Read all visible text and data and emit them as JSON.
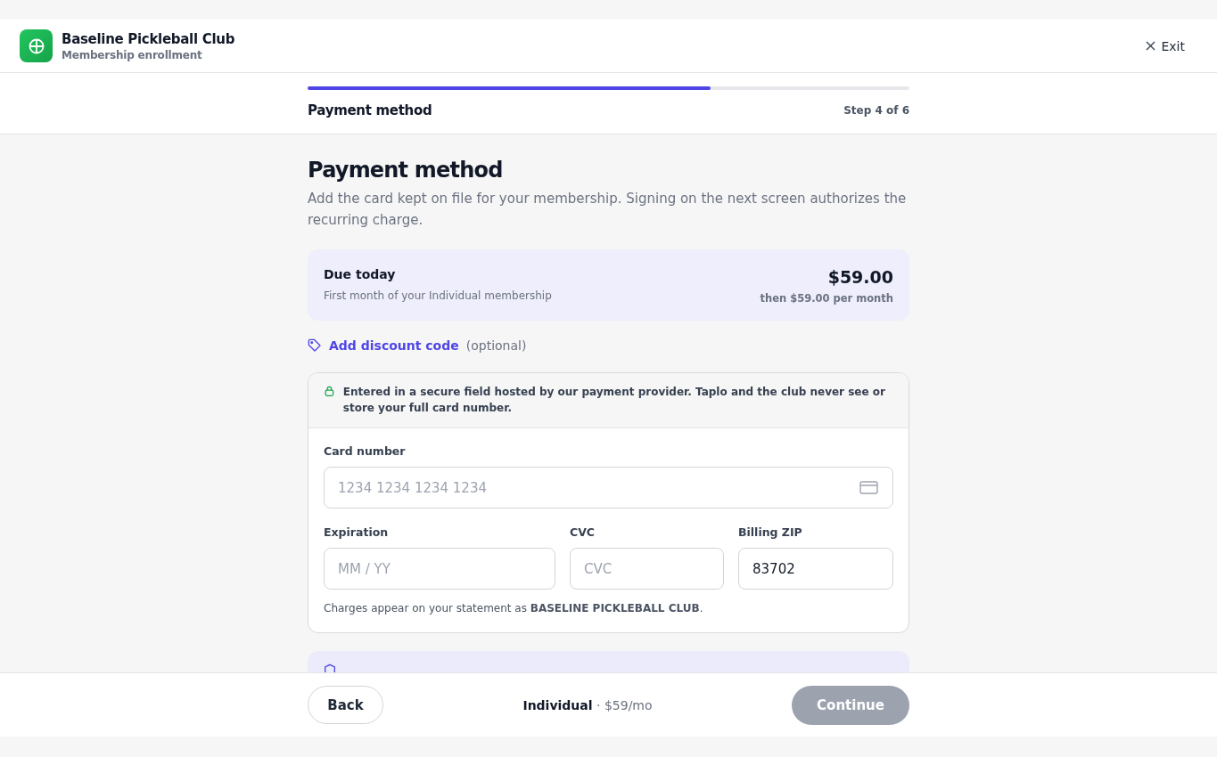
{
  "header": {
    "title": "Baseline Pickleball Club",
    "subtitle": "Membership enrollment",
    "exit": "Exit"
  },
  "progress": {
    "label": "Payment method",
    "step": "Step 4 of 6",
    "level": 0.67
  },
  "page": {
    "title": "Payment method",
    "description": "Add the card kept on file for your membership. Signing on the next screen authorizes the recurring charge."
  },
  "due": {
    "label": "Due today",
    "note": "First month of your Individual membership",
    "amount": "$59.00",
    "recurring": "then $59.00 per month"
  },
  "discount": {
    "link": "Add discount code",
    "hint": "(optional)"
  },
  "card_form": {
    "notice": "Entered in a secure field hosted by our payment provider. Taplo and the club never see or store your full card number.",
    "card_number": {
      "label": "Card number",
      "placeholder": "1234 1234 1234 1234"
    },
    "fields": [
      {
        "label": "Expiration",
        "placeholder": "MM / YY"
      },
      {
        "label": "CVC",
        "placeholder": "CVC"
      },
      {
        "label": "Billing ZIP",
        "value": "83702"
      }
    ],
    "statement": "Charges appear on your statement as **BASELINE PICKLEBALL CLUB**."
  },
  "footer": {
    "back": "Back",
    "plan": "Individual",
    "price": " · $59/mo",
    "continue": "Continue",
    "continue_disabled": true
  }
}
